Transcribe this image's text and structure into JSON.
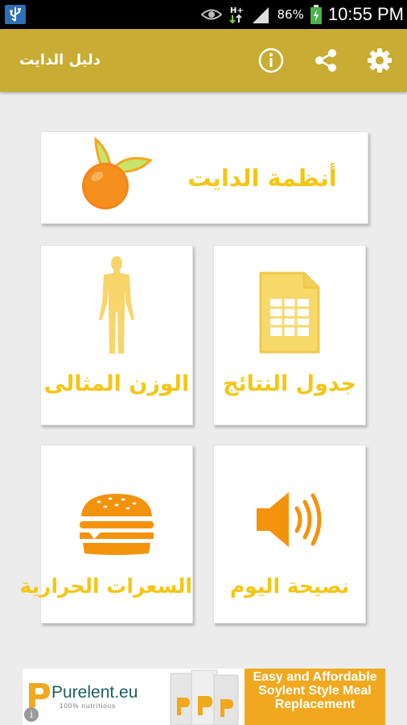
{
  "status_bar": {
    "battery_percent": "86%",
    "time": "10:55 PM"
  },
  "app_bar": {
    "title": "دليل الدايت",
    "icons": [
      "info-icon",
      "share-icon",
      "settings-gear-icon"
    ]
  },
  "menu": {
    "diet_systems": "أنظمة الدايت",
    "results_table": "جدول النتائج",
    "ideal_weight": "الوزن المثالى",
    "daily_advice": "نصيحة اليوم",
    "calories": "السعرات الحرارية"
  },
  "ad": {
    "brand": "Purelent.eu",
    "tagline": "100% nutritious",
    "headline": "Easy and Affordable Soylent Style Meal Replacement"
  },
  "colors": {
    "app_bar": "#c8ac33",
    "label_yellow": "#f4c614",
    "icon_orange": "#f3930c",
    "icon_yellow": "#f7d96a"
  }
}
